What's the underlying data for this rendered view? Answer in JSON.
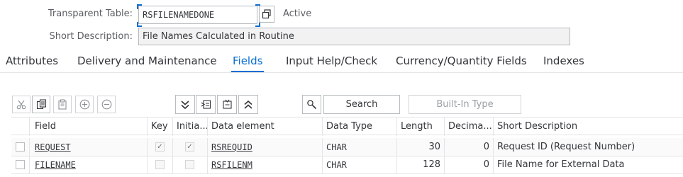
{
  "header": {
    "table_label": "Transparent Table:",
    "table_name": "RSFILENAMEDONE",
    "status": "Active",
    "desc_label": "Short Description:",
    "description": "File Names Calculated in Routine"
  },
  "tabs": [
    {
      "label": "Attributes",
      "active": false
    },
    {
      "label": "Delivery and Maintenance",
      "active": false
    },
    {
      "label": "Fields",
      "active": true
    },
    {
      "label": "Input Help/Check",
      "active": false
    },
    {
      "label": "Currency/Quantity Fields",
      "active": false
    },
    {
      "label": "Indexes",
      "active": false
    }
  ],
  "toolbar": {
    "search_label": "Search",
    "builtin_label": "Built-In Type",
    "icons": [
      "cut-icon",
      "copy-icon",
      "paste-icon",
      "insert-row-icon",
      "delete-row-icon",
      "expand-icon",
      "insert-structure-icon",
      "collapse-structure-icon",
      "collapse-icon",
      "search-icon"
    ]
  },
  "table": {
    "columns": [
      "Field",
      "Key",
      "Initia...",
      "Data element",
      "Data Type",
      "Length",
      "Decima...",
      "Short Description"
    ],
    "rows": [
      {
        "field": "REQUEST",
        "key": true,
        "initial": true,
        "data_element": "RSREQUID",
        "data_type": "CHAR",
        "length": "30",
        "decimals": "0",
        "description": "Request ID (Request Number)"
      },
      {
        "field": "FILENAME",
        "key": false,
        "initial": false,
        "data_element": "RSFILENM",
        "data_type": "CHAR",
        "length": "128",
        "decimals": "0",
        "description": "File Name for External Data"
      }
    ]
  },
  "colors": {
    "accent": "#0a6ed1",
    "border": "#b3b8bc",
    "text": "#32363a"
  }
}
